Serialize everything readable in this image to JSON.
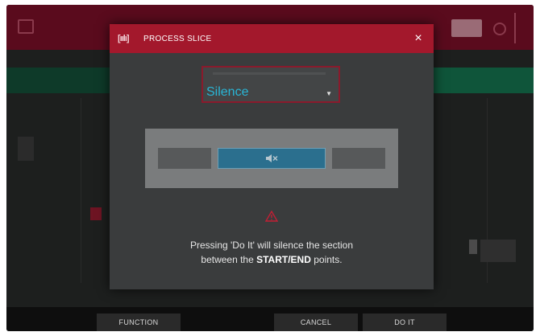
{
  "background": {
    "softkeys": {
      "function": "FUNCTION",
      "cancel": "CANCEL",
      "doit": "DO IT"
    }
  },
  "dialog": {
    "logo_text": "[ıılı]",
    "title": "PROCESS SLICE",
    "close_glyph": "×",
    "select": {
      "value": "Silence",
      "caret": "▼"
    },
    "preview": {
      "selected_segment_icon": "mute-speaker-icon"
    },
    "warning_icon": "warning-triangle-icon",
    "message": {
      "line1": "Pressing 'Do It' will silence the section",
      "line2_prefix": "between the ",
      "line2_bold": "START/END",
      "line2_suffix": " points."
    }
  },
  "colors": {
    "header_red": "#a3182c",
    "dialog_bg": "#3a3c3d",
    "accent_cyan": "#29b6d6",
    "selected_blue": "#2b6f8e"
  }
}
